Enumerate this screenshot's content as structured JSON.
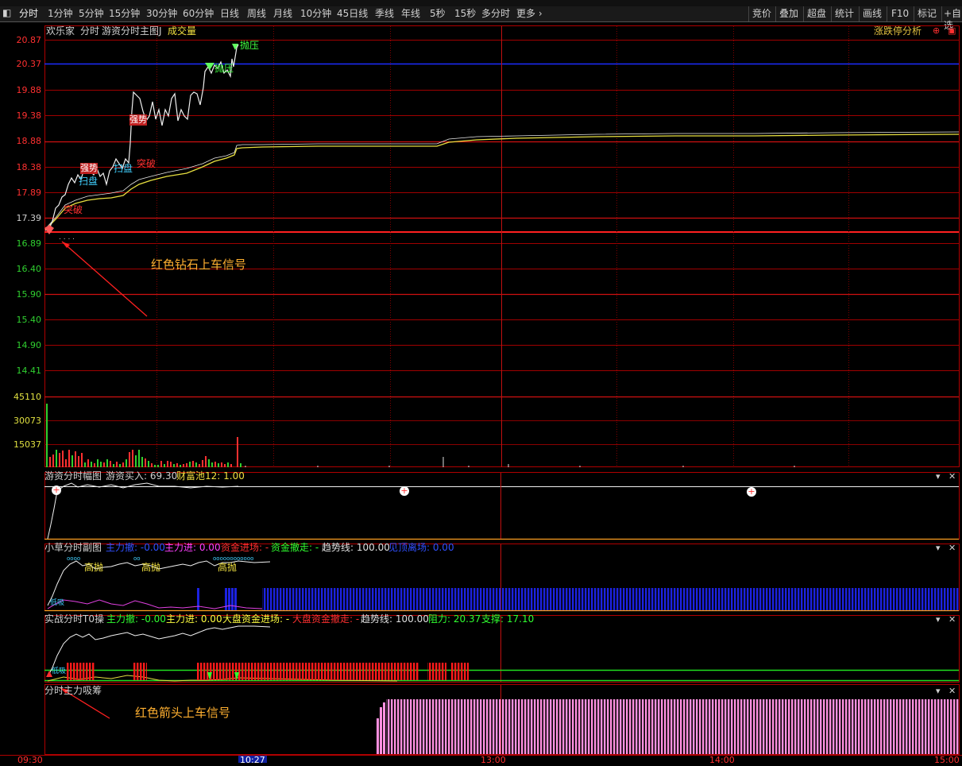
{
  "periods": {
    "tabs": [
      "分时",
      "1分钟",
      "5分钟",
      "15分钟",
      "30分钟",
      "60分钟",
      "日线",
      "周线",
      "月线",
      "10分钟",
      "45日线",
      "季线",
      "年线",
      "5秒",
      "15秒",
      "多分时",
      "更多 ›"
    ],
    "active": "分时",
    "right_tabs": [
      "竞价",
      "叠加",
      "超盘",
      "统计",
      "画线",
      "F10",
      "标记",
      "+自选"
    ]
  },
  "main_panel": {
    "stock_name": "欢乐家",
    "mode": "分时",
    "indicator": "游资分时主图J",
    "volume_label": "成交量",
    "right_link": "涨跌停分析",
    "price_ticks": [
      "20.87",
      "20.37",
      "19.88",
      "19.38",
      "18.88",
      "18.38",
      "17.89",
      "17.39",
      "16.89",
      "16.40",
      "15.90",
      "15.40",
      "14.90",
      "14.41"
    ],
    "volume_ticks": [
      "45110",
      "30073",
      "15037"
    ],
    "markers": [
      "抛压",
      "抛压",
      "强势",
      "强势",
      "扫盘",
      "扫盘",
      "突破",
      "突破"
    ],
    "annotation": "红色钻石上车信号"
  },
  "panel2": {
    "title": "游资分时幅图",
    "label1": "游资买入: 69.30",
    "label2": "财富池12: 1.00"
  },
  "panel3": {
    "title": "小草分时副图",
    "items": [
      {
        "text": "主力撤: -0.00",
        "color": "#3050ff"
      },
      {
        "text": "主力进: 0.00",
        "color": "#ff40ff"
      },
      {
        "text": "资金进场: -",
        "color": "#ff3030"
      },
      {
        "text": "资金撤走: -",
        "color": "#30ff30"
      },
      {
        "text": "趋势线: 100.00",
        "color": "#e0e0e0"
      },
      {
        "text": "见顶离场: 0.00",
        "color": "#3050ff"
      }
    ],
    "markers": [
      "高抛",
      "高抛",
      "高抛"
    ],
    "low_label": "低吸"
  },
  "panel4": {
    "title": "实战分时T0操",
    "items": [
      {
        "text": "主力撤: -0.00",
        "color": "#30ff30"
      },
      {
        "text": "主力进: 0.00",
        "color": "#ffff40"
      },
      {
        "text": "大盘资金进场: -",
        "color": "#ffff40"
      },
      {
        "text": "大盘资金撤走: -",
        "color": "#ff3030"
      },
      {
        "text": "趋势线: 100.00",
        "color": "#e0e0e0"
      },
      {
        "text": "阻力: 20.37",
        "color": "#30ff30"
      },
      {
        "text": "支撑: 17.10",
        "color": "#30ff30"
      }
    ],
    "low_label": "低吸"
  },
  "panel5": {
    "title": "分时主力吸筹",
    "annotation": "红色箭头上车信号"
  },
  "time_axis": [
    "09:30",
    "10:27",
    "13:00",
    "14:00",
    "15:00"
  ]
}
